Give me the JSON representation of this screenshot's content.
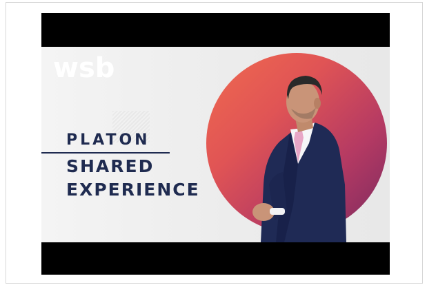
{
  "video": {
    "logo": "wsb",
    "title_line1": "PLATON",
    "title_line2": "SHARED",
    "title_line3": "EXPERIENCE"
  },
  "colors": {
    "navy": "#1f2b50",
    "circle_start": "#f06a4f",
    "circle_end": "#7a2a5f",
    "background": "#efefef"
  }
}
